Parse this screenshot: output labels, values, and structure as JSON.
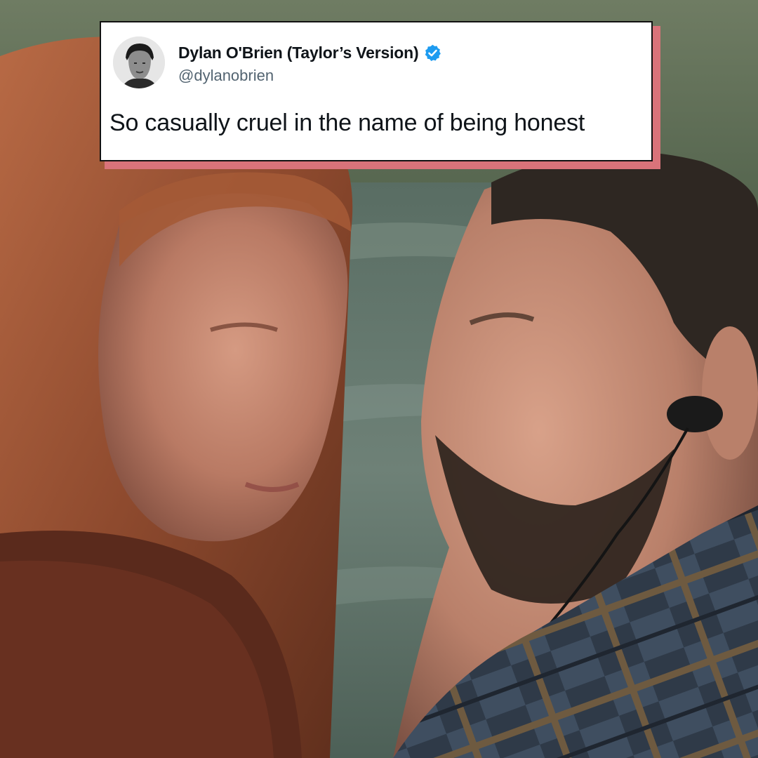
{
  "tweet": {
    "display_name": "Dylan O'Brien (Taylor’s Version)",
    "handle": "@dylanobrien",
    "text": "So casually cruel in the name of being honest",
    "avatar_icon": "profile-photo",
    "verified_icon": "verified-badge-icon",
    "verified_color": "#1d9bf0",
    "card_shadow_color": "#d9737a"
  },
  "photo": {
    "description_icon": "film-still-couple-by-river"
  }
}
